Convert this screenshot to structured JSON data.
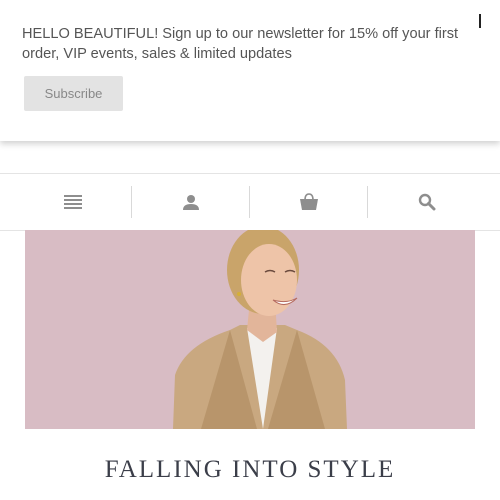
{
  "banner": {
    "message": "HELLO BEAUTIFUL! Sign up to our newsletter for 15% off your first order, VIP events, sales & limited updates",
    "subscribe_label": "Subscribe"
  },
  "nav": {
    "items": [
      {
        "name": "menu",
        "icon": "menu-icon"
      },
      {
        "name": "account",
        "icon": "user-icon"
      },
      {
        "name": "cart",
        "icon": "shopping-bag-icon"
      },
      {
        "name": "search",
        "icon": "search-icon"
      }
    ],
    "icon_color": "#8e8e8e"
  },
  "hero": {
    "image": "woman-laughing-camel-blazer",
    "background_color": "#d8bcc4"
  },
  "headline": "FALLING INTO STYLE"
}
